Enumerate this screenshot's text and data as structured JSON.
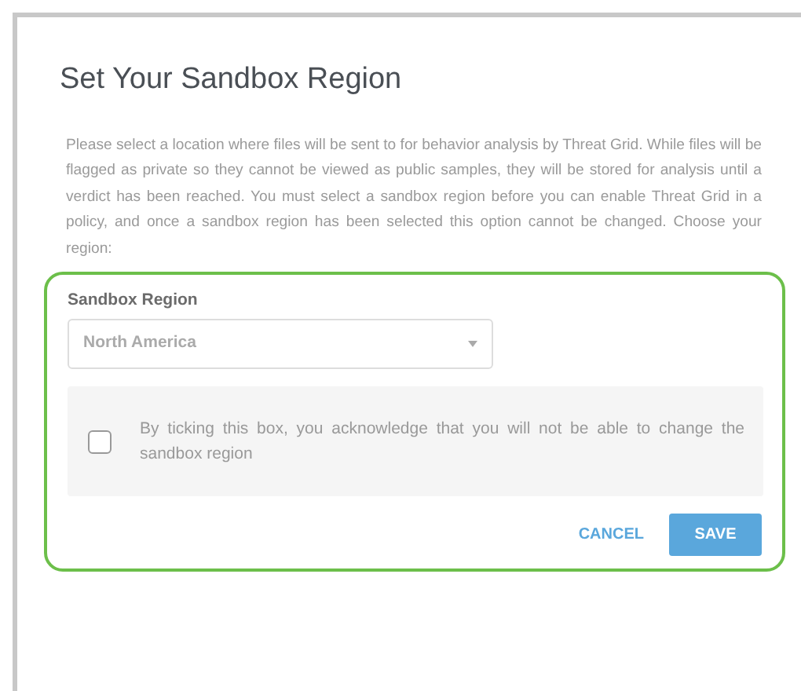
{
  "dialog": {
    "title": "Set Your Sandbox Region",
    "description": "Please select a location where files will be sent to for behavior analysis by Threat Grid. While files will be flagged as private so they cannot be viewed as public samples, they will be stored for analysis until a verdict has been reached. You must select a sandbox region before you can enable Threat Grid in a policy, and once a sandbox region has been selected this option cannot be changed. Choose your region:",
    "region_field": {
      "label": "Sandbox Region",
      "value": "North America"
    },
    "acknowledgement": {
      "label": "By ticking this box, you acknowledge that you will not be able to change the sandbox region",
      "checked": false
    },
    "buttons": [
      {
        "label": "CANCEL",
        "kind": "link"
      },
      {
        "label": "SAVE",
        "kind": "primary"
      }
    ]
  }
}
